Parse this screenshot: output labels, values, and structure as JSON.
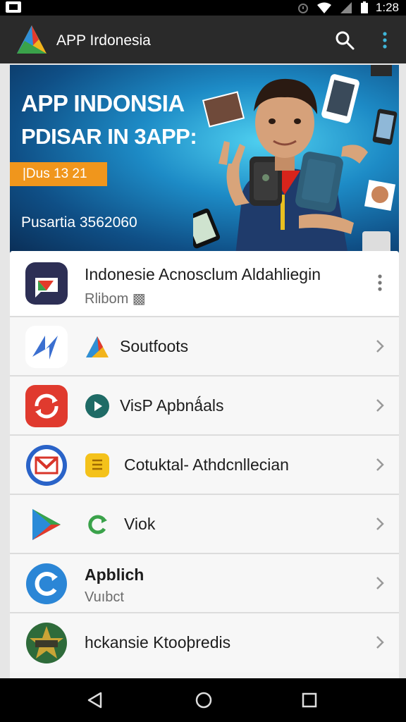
{
  "status_bar": {
    "time": "1:28"
  },
  "app_bar": {
    "title": "APP Irdonesia"
  },
  "banner": {
    "headline_1": "APP INDONSIA",
    "headline_2": "PDISAR IN 3APP:",
    "badge": "|Dus 13 21",
    "subtitle": "Pusartia 3562060"
  },
  "list": [
    {
      "title": "Indonesie Acnosclum Aldahliegin",
      "subtitle": "Rlibom ▩",
      "icon": "play-store-chat-icon",
      "action": "kebab"
    },
    {
      "title": "Soutfoots",
      "subtitle": "",
      "icon": "lightning-icon",
      "sub_icon": "triangle-logo-icon",
      "action": "chevron"
    },
    {
      "title": "VisP Apbnǻals",
      "subtitle": "",
      "icon": "sync-icon",
      "sub_icon": "play-circle-icon",
      "action": "chevron"
    },
    {
      "title": "Cotuktal- Athdcnllecian",
      "subtitle": "",
      "icon": "gmail-icon",
      "sub_icon": "notes-icon",
      "action": "chevron"
    },
    {
      "title": "Viok",
      "subtitle": "",
      "icon": "play-triangle-icon",
      "sub_icon": "refresh-c-icon",
      "action": "chevron"
    },
    {
      "title": "Apblich",
      "subtitle": "Vuıbct",
      "icon": "c-refresh-icon",
      "action": "chevron"
    },
    {
      "title": "hckansie Ktooþredis",
      "subtitle": "",
      "icon": "star-badge-icon",
      "action": "chevron"
    }
  ],
  "colors": {
    "appbar": "#2a2a2a",
    "badge": "#f0961c",
    "banner_blue": "#1d8bc6"
  }
}
